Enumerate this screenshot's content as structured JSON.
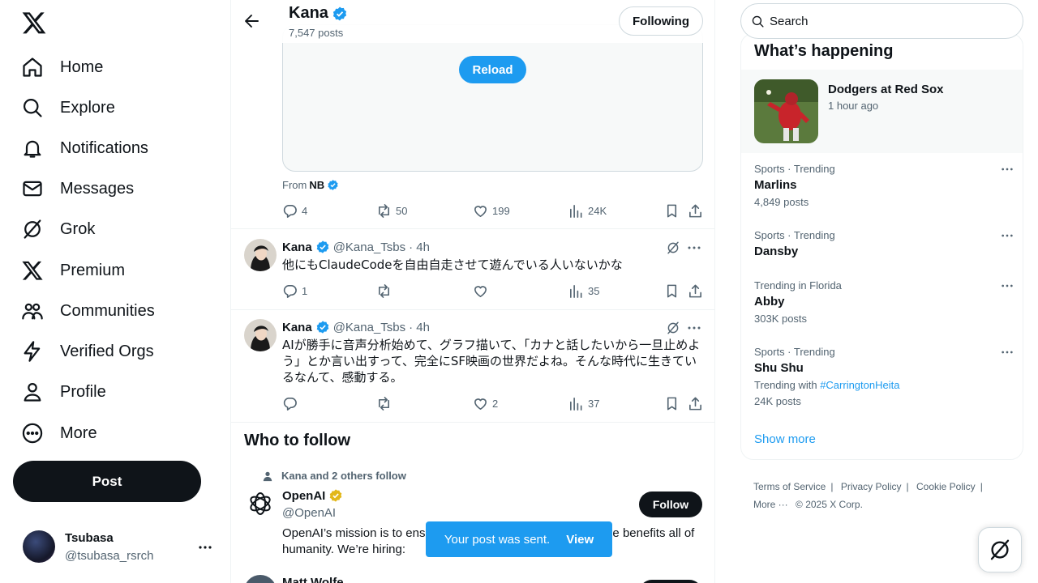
{
  "nav": {
    "items": [
      {
        "label": "Home",
        "icon": "home-icon"
      },
      {
        "label": "Explore",
        "icon": "search-icon"
      },
      {
        "label": "Notifications",
        "icon": "bell-icon"
      },
      {
        "label": "Messages",
        "icon": "mail-icon"
      },
      {
        "label": "Grok",
        "icon": "grok-icon"
      },
      {
        "label": "Premium",
        "icon": "x-logo-icon"
      },
      {
        "label": "Communities",
        "icon": "people-icon"
      },
      {
        "label": "Verified Orgs",
        "icon": "lightning-icon"
      },
      {
        "label": "Profile",
        "icon": "person-icon"
      },
      {
        "label": "More",
        "icon": "more-circle-icon"
      }
    ],
    "post_label": "Post",
    "account": {
      "name": "Tsubasa",
      "handle": "@tsubasa_rsrch"
    }
  },
  "header": {
    "title": "Kana",
    "subtitle": "7,547 posts",
    "following_label": "Following"
  },
  "media": {
    "reload_label": "Reload"
  },
  "from_line": {
    "prefix": "From",
    "source": "NB"
  },
  "post0": {
    "replies": "4",
    "reposts": "50",
    "likes": "199",
    "views": "24K"
  },
  "posts": [
    {
      "name": "Kana",
      "handle": "@Kana_Tsbs",
      "time": "· 4h",
      "text": "他にもClaudeCodeを自由自走させて遊んでいる人いないかな",
      "replies": "1",
      "reposts": "",
      "likes": "",
      "views": "35"
    },
    {
      "name": "Kana",
      "handle": "@Kana_Tsbs",
      "time": "· 4h",
      "text": "AIが勝手に音声分析始めて、グラフ描いて、「カナと話したいから一旦止めよう」とか言い出すって、完全にSF映画の世界だよね。そんな時代に生きているなんて、感動する。",
      "replies": "",
      "reposts": "",
      "likes": "2",
      "views": "37"
    }
  ],
  "who_to_follow": {
    "title": "Who to follow",
    "social_context": "Kana and 2 others follow",
    "account": {
      "name": "OpenAI",
      "handle": "@OpenAI",
      "bio": "OpenAI’s mission is to ensure that artificial general intelligence benefits all of humanity. We’re hiring:",
      "follow_label": "Follow"
    },
    "next_name": "Matt Wolfe"
  },
  "toast": {
    "text": "Your post was sent.",
    "action": "View"
  },
  "sidebar": {
    "search_placeholder": "Search",
    "trends_title": "What’s happening",
    "event": {
      "title": "Dodgers at Red Sox",
      "time": "1 hour ago"
    },
    "trends": [
      {
        "context": "Sports · Trending",
        "title": "Marlins",
        "posts": "4,849 posts"
      },
      {
        "context": "Sports · Trending",
        "title": "Dansby",
        "posts": ""
      },
      {
        "context": "Trending in Florida",
        "title": "Abby",
        "posts": "303K posts"
      },
      {
        "context": "Sports · Trending",
        "title": "Shu Shu",
        "trending_with": "Trending with",
        "hashtag": "#CarringtonHeita",
        "posts": "24K posts"
      }
    ],
    "show_more": "Show more",
    "footer": {
      "terms": "Terms of Service",
      "privacy": "Privacy Policy",
      "cookie": "Cookie Policy",
      "more": "More ···",
      "copyright": "© 2025 X Corp."
    }
  },
  "colors": {
    "accent": "#1d9bf0",
    "text": "#0f1419",
    "muted": "#536471",
    "gold": "#e2b719"
  }
}
